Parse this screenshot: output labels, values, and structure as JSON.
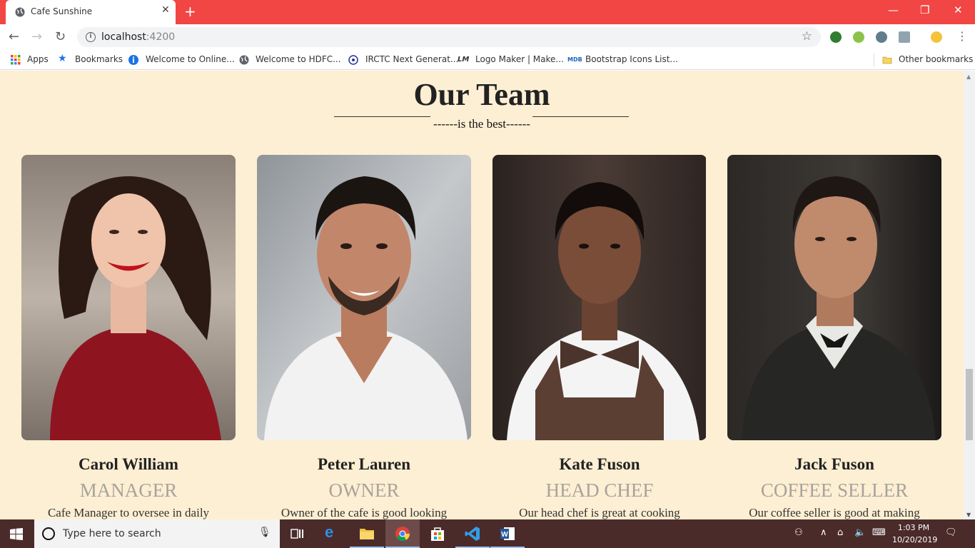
{
  "browser": {
    "tab_title": "Cafe Sunshine",
    "tab_close": "✕",
    "new_tab": "+",
    "url_host": "localhost",
    "url_port": ":4200",
    "window_controls": {
      "minimize": "—",
      "restore": "❐",
      "close": "✕"
    }
  },
  "bookmarks": [
    {
      "label": "Apps",
      "icon": "apps-grid-icon"
    },
    {
      "label": "Bookmarks",
      "icon": "star-icon"
    },
    {
      "label": "Welcome to Online...",
      "icon": "info-icon"
    },
    {
      "label": "Welcome to HDFC...",
      "icon": "globe-icon"
    },
    {
      "label": "IRCTC Next Generat...",
      "icon": "irctc-icon"
    },
    {
      "label": "Logo Maker | Make...",
      "icon": "lm-icon"
    },
    {
      "label": "Bootstrap Icons List...",
      "icon": "mdb-icon"
    },
    {
      "label": "Other bookmarks",
      "icon": "folder-icon"
    }
  ],
  "page": {
    "heading": "Our Team",
    "subheading": "------is the best------",
    "team": [
      {
        "name": "Carol William",
        "role": "MANAGER",
        "desc": "Cafe Manager to oversee in daily"
      },
      {
        "name": "Peter Lauren",
        "role": "OWNER",
        "desc": "Owner of the cafe is good looking"
      },
      {
        "name": "Kate Fuson",
        "role": "HEAD CHEF",
        "desc": "Our head chef is great at cooking"
      },
      {
        "name": "Jack Fuson",
        "role": "COFFEE SELLER",
        "desc": "Our coffee seller is good at making"
      }
    ]
  },
  "taskbar": {
    "search_placeholder": "Type here to search",
    "time": "1:03 PM",
    "date": "10/20/2019"
  },
  "colors": {
    "titlebar": "#f14644",
    "page_bg": "#fdefd3",
    "taskbar": "#4b2a2a",
    "role_text": "#a8a39b"
  }
}
